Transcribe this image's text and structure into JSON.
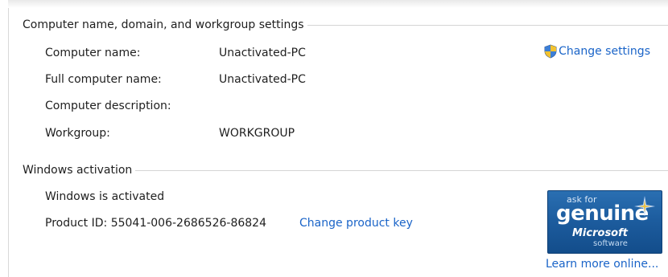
{
  "computer_section": {
    "title": "Computer name, domain, and workgroup settings",
    "change_settings_label": "Change settings",
    "rows": [
      {
        "label": "Computer name:",
        "value": "Unactivated-PC"
      },
      {
        "label": "Full computer name:",
        "value": "Unactivated-PC"
      },
      {
        "label": "Computer description:",
        "value": ""
      },
      {
        "label": "Workgroup:",
        "value": "WORKGROUP"
      }
    ]
  },
  "activation_section": {
    "title": "Windows activation",
    "status": "Windows is activated",
    "product_id_label": "Product ID:",
    "product_id": "55041-006-2686526-86824",
    "change_key_label": "Change product key",
    "learn_more_label": "Learn more online...",
    "badge": {
      "ask_for": "ask for",
      "genuine": "genuine",
      "microsoft": "Microsoft",
      "software": "software"
    }
  },
  "colors": {
    "link": "#1a64c8",
    "badge_blue": "#1d5d9f"
  },
  "icons": {
    "uac_shield": "shield-icon",
    "genuine_star": "star-icon"
  }
}
